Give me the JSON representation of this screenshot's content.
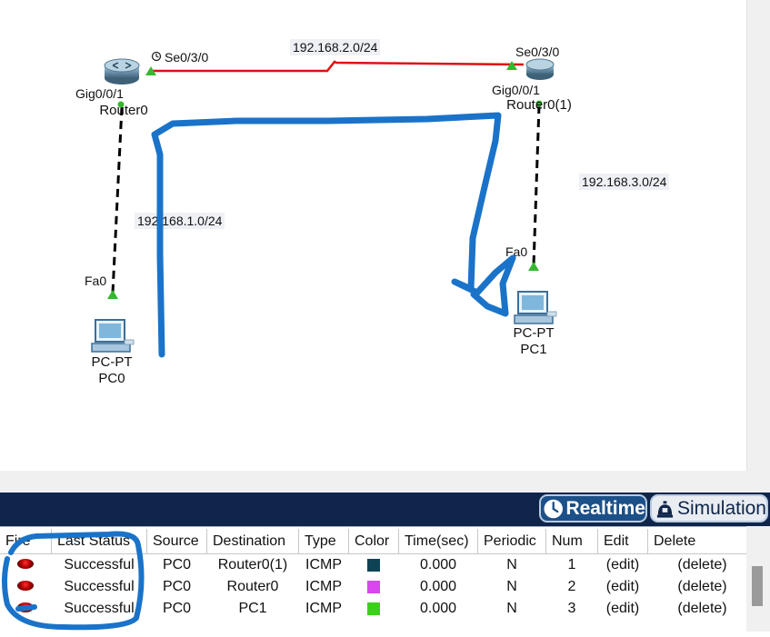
{
  "topology": {
    "routers": [
      {
        "name": "Router0",
        "serial_port": "Se0/3/0",
        "gig_port": "Gig0/0/1"
      },
      {
        "name": "Router0(1)",
        "serial_port": "Se0/3/0",
        "gig_port": "Gig0/0/1"
      }
    ],
    "pcs": [
      {
        "type": "PC-PT",
        "name": "PC0",
        "port": "Fa0"
      },
      {
        "type": "PC-PT",
        "name": "PC1",
        "port": "Fa0"
      }
    ],
    "networks": {
      "wan": "192.168.2.0/24",
      "lan_left": "192.168.1.0/24",
      "lan_right": "192.168.3.0/24"
    },
    "colors": {
      "serial_link": "#e01010",
      "link_up": "#35b82e",
      "copper_link": "#000000"
    }
  },
  "mode_bar": {
    "realtime_label": "Realtime",
    "simulation_label": "Simulation",
    "active": "Realtime"
  },
  "pdu_list": {
    "columns": [
      "Fire",
      "Last Status",
      "Source",
      "Destination",
      "Type",
      "Color",
      "Time(sec)",
      "Periodic",
      "Num",
      "Edit",
      "Delete"
    ],
    "rows": [
      {
        "last_status": "Successful",
        "source": "PC0",
        "destination": "Router0(1)",
        "type": "ICMP",
        "color": "#0e4356",
        "time": "0.000",
        "periodic": "N",
        "num": "1",
        "edit": "(edit)",
        "delete": "(delete)"
      },
      {
        "last_status": "Successful",
        "source": "PC0",
        "destination": "Router0",
        "type": "ICMP",
        "color": "#d946ef",
        "time": "0.000",
        "periodic": "N",
        "num": "2",
        "edit": "(edit)",
        "delete": "(delete)"
      },
      {
        "last_status": "Successful",
        "source": "PC0",
        "destination": "PC1",
        "type": "ICMP",
        "color": "#39d219",
        "time": "0.000",
        "periodic": "N",
        "num": "3",
        "edit": "(edit)",
        "delete": "(delete)"
      }
    ]
  },
  "annotation_color": "#1a73c9"
}
